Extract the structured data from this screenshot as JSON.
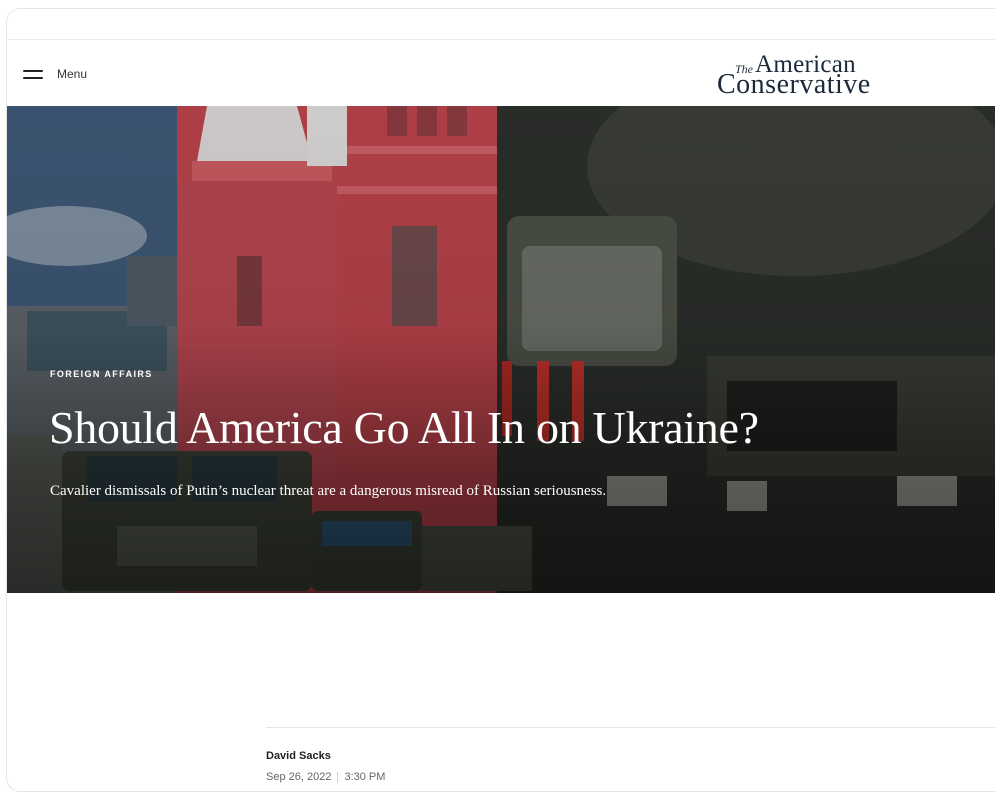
{
  "header": {
    "menu_label": "Menu",
    "logo": {
      "the": "The",
      "american": "American",
      "conservative": "Conservative"
    }
  },
  "hero": {
    "kicker": "FOREIGN AFFAIRS",
    "headline": "Should America Go All In on Ukraine?",
    "dek": "Cavalier dismissals of Putin’s nuclear threat are a dangerous misread of Russian seriousness."
  },
  "byline": {
    "author": "David Sacks",
    "date": "Sep 26, 2022",
    "time": "3:30 PM"
  },
  "colors": {
    "logo": "#1b2a3a",
    "building_red": "#b8424a",
    "vehicle_green": "#3e4439"
  },
  "icons": {
    "menu": "hamburger-icon"
  }
}
